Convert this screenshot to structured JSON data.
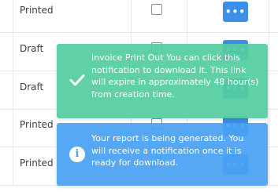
{
  "table": {
    "rows": [
      {
        "status": "Printed",
        "checked": false,
        "more_label": "•••"
      },
      {
        "status": "Draft",
        "checked": false,
        "more_label": "•••"
      },
      {
        "status": "Draft",
        "checked": false,
        "more_label": "•••"
      },
      {
        "status": "Printed",
        "checked": false,
        "more_label": "•••"
      },
      {
        "status": "Printed",
        "checked": false,
        "more_label": "•••"
      }
    ]
  },
  "toasts": {
    "success": {
      "icon": "checkmark-icon",
      "color": "#54cea0",
      "message": "Invoice Print Out You can click this notification to download it. This link will expire in approximately 48 hour(s) from creation time."
    },
    "info": {
      "icon": "info-icon",
      "icon_glyph": "i",
      "color": "#49a1f3",
      "message": "Your report is being generated. You will receive a notification once it is ready for download."
    }
  }
}
